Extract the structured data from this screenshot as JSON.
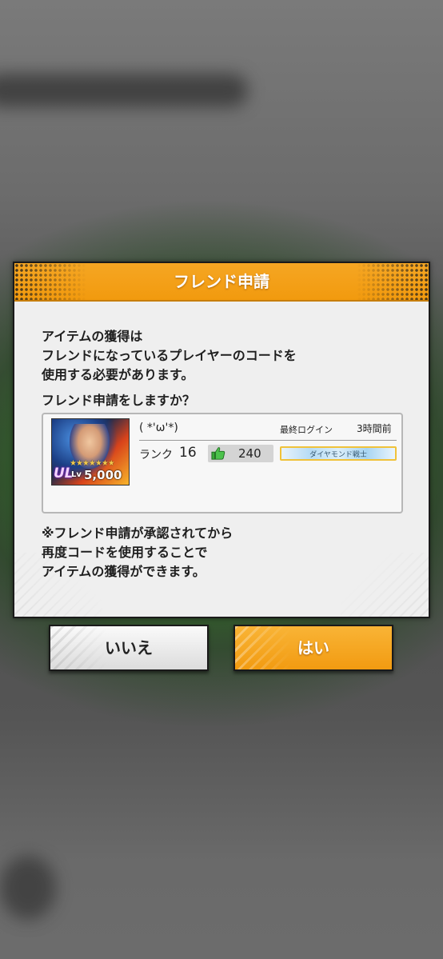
{
  "dialog": {
    "title": "フレンド申請",
    "message_lines": [
      "アイテムの獲得は",
      "フレンドになっているプレイヤーのコードを",
      "使用する必要があります。"
    ],
    "question": "フレンド申請をしますか？",
    "player": {
      "name": "( *'ω'*)",
      "last_login_label": "最終ログイン",
      "last_login_time": "3時間前",
      "rank_label": "ランク",
      "rank_value": "16",
      "likes": "240",
      "class_badge": "ダイヤモンド戦士",
      "avatar_badge": "UL",
      "level_label": "Lv",
      "level_value": "5,000",
      "stars": "★★★★★★★"
    },
    "footer_lines": [
      "※フレンド申請が承認されてから",
      "再度コードを使用することで",
      "アイテムの獲得ができます。"
    ]
  },
  "buttons": {
    "no_label": "いいえ",
    "yes_label": "はい"
  },
  "colors": {
    "accent_orange": "#f5a623",
    "like_green": "#3aa83a"
  }
}
